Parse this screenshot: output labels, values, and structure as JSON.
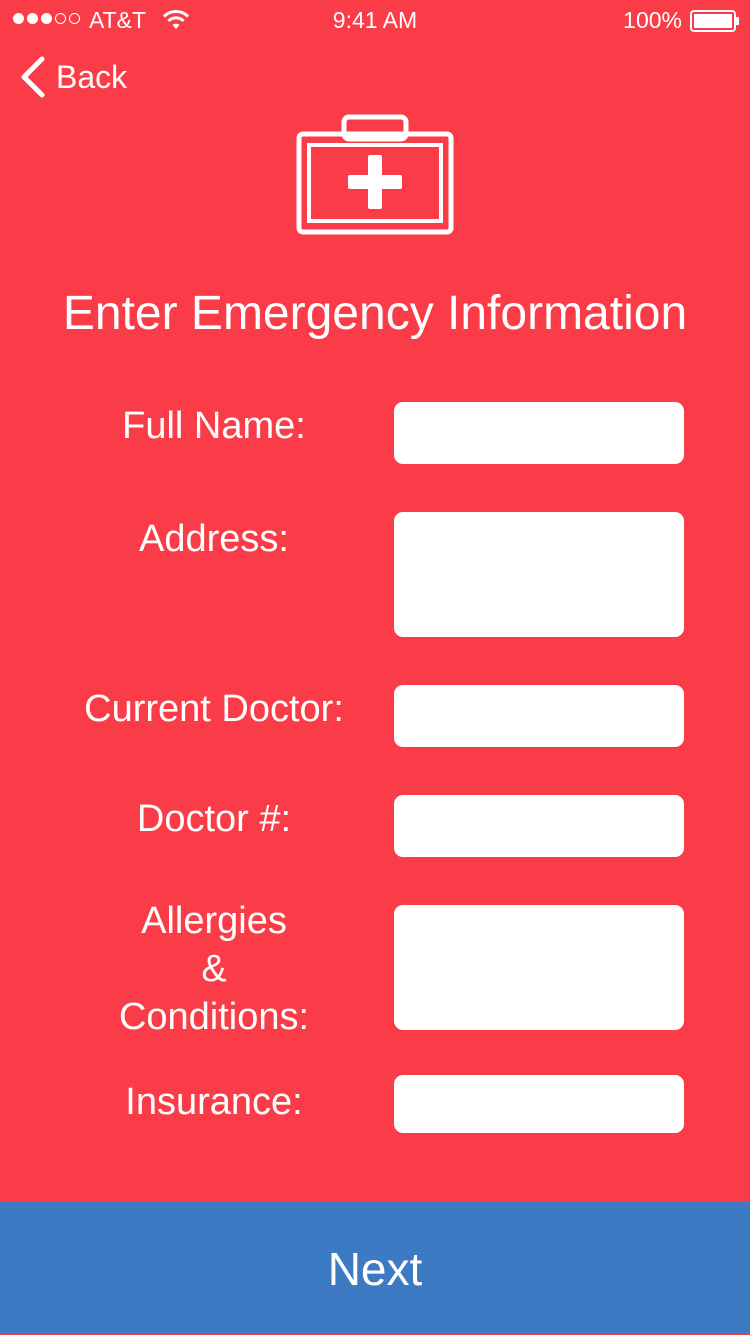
{
  "status_bar": {
    "carrier": "AT&T",
    "time": "9:41 AM",
    "battery": "100%",
    "signal_bars_filled": 3,
    "signal_bars_total": 5
  },
  "nav": {
    "back_label": "Back"
  },
  "header": {
    "icon": "first-aid-kit-icon",
    "title": "Enter Emergency Information"
  },
  "form": {
    "full_name": {
      "label": "Full Name:",
      "value": ""
    },
    "address": {
      "label": "Address:",
      "value": ""
    },
    "current_doctor": {
      "label": "Current Doctor:",
      "value": ""
    },
    "doctor_number": {
      "label": "Doctor #:",
      "value": ""
    },
    "allergies": {
      "label_line1": "Allergies",
      "label_line2": "&",
      "label_line3": "Conditions:",
      "value": ""
    },
    "insurance": {
      "label": "Insurance:",
      "value": ""
    }
  },
  "footer": {
    "next_label": "Next"
  },
  "colors": {
    "background": "#F93C47",
    "next_button": "#3C7BC4",
    "input": "#FFFFFF",
    "text": "#FFFFFF"
  }
}
